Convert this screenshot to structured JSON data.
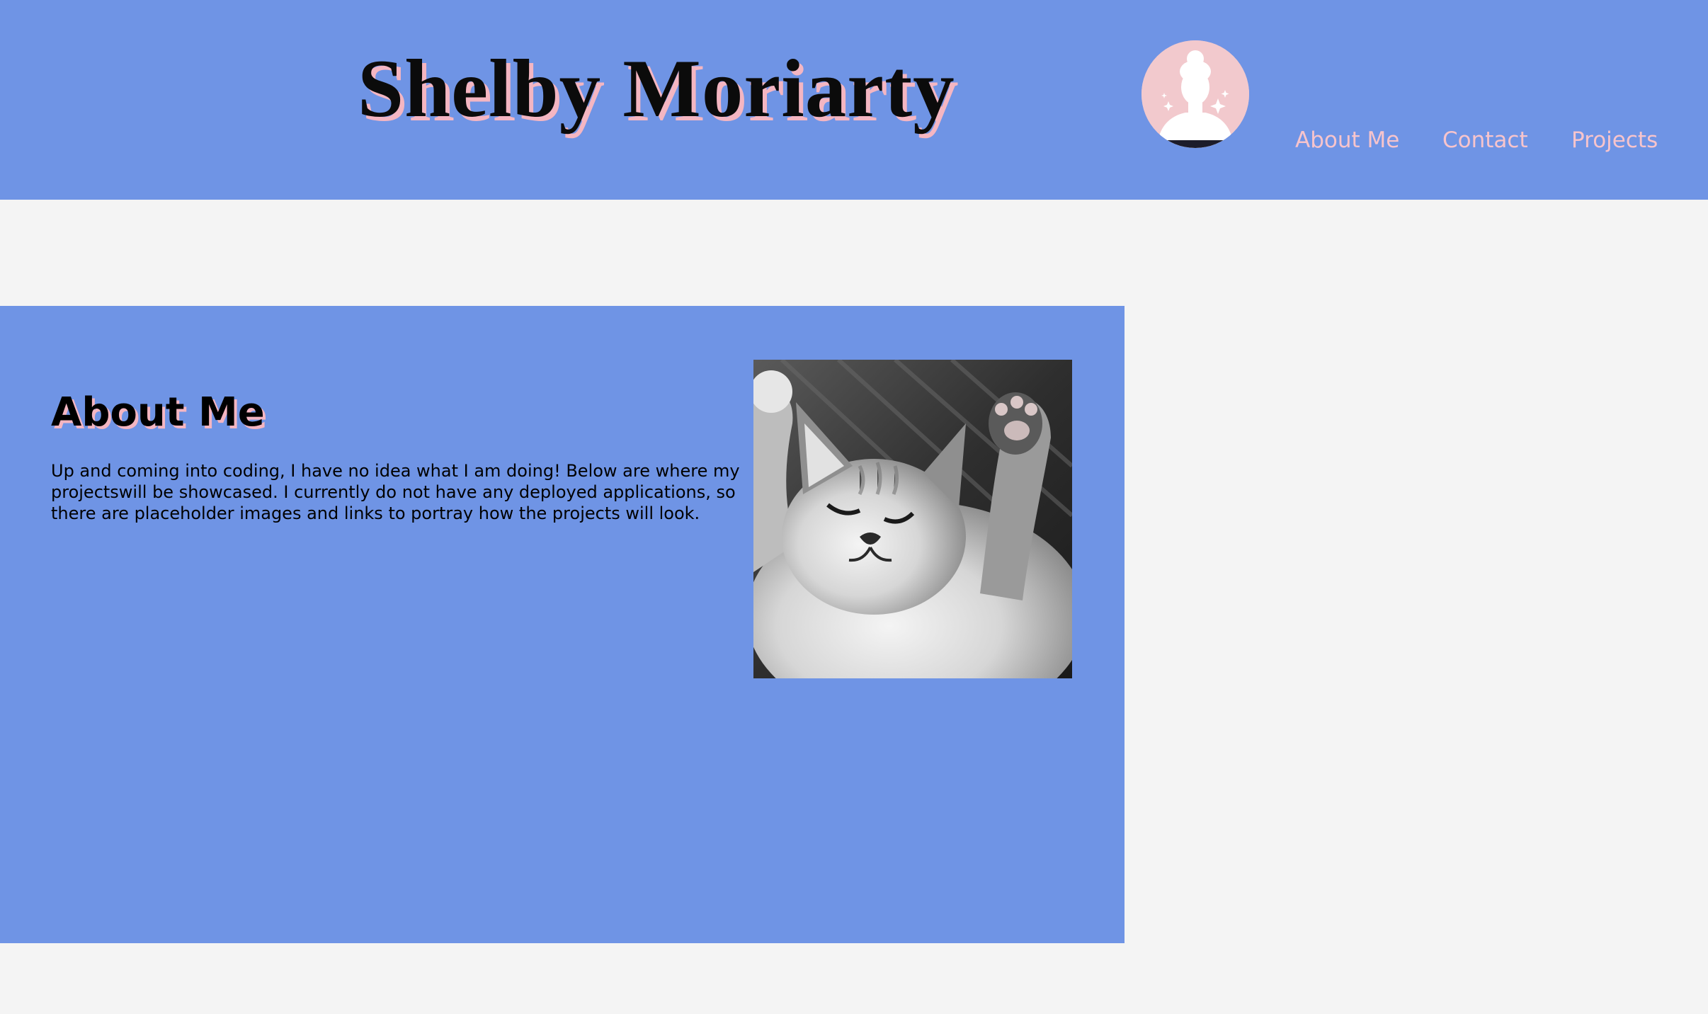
{
  "header": {
    "title": "Shelby Moriarty",
    "avatar_icon": "woman-silhouette-avatar-icon"
  },
  "nav": {
    "items": [
      {
        "label": "About Me"
      },
      {
        "label": "Contact"
      },
      {
        "label": "Projects"
      }
    ]
  },
  "about": {
    "heading": "About Me",
    "text": "Up and coming into coding, I have no idea what I am doing! Below are where my projectswill be showcased. I currently do not have any deployed applications, so there are placeholder images and links to portray how the projects will look.",
    "image_icon": "kitten-photo"
  },
  "colors": {
    "header_bg": "#6f94e5",
    "page_bg": "#f4f4f4",
    "nav_link": "#f7c4cc",
    "title_shadow": "#f4b6c2",
    "avatar_bg": "#f2c9cd"
  }
}
